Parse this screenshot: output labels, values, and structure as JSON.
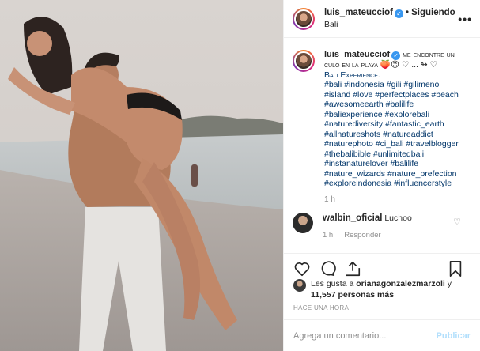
{
  "post": {
    "username": "luis_mateucciof",
    "following_label": "Siguiendo",
    "location": "Bali",
    "more_icon": "ellipsis-icon",
    "photo_alt": "Foto de la publicación"
  },
  "caption": {
    "username": "luis_mateucciof",
    "text": "me encontre un culo en la playa 🍑😉 ♡ ... ↬ ♡",
    "line2": "Bali Experience.",
    "hashtags": "#bali #indonesia #gili #gilimeno #island #love #perfectplaces #beach #awesomeearth #balilife #baliexperience #explorebali #naturediversity #fantastic_earth #allnatureshots #natureaddict #naturephoto #ci_bali #travelblogger #thebalibible #unlimitedbali #instanaturelover #balilife #nature_wizards #nature_prefection #exploreindonesia #influencerstyle",
    "time": "1 h"
  },
  "comment": {
    "username": "walbin_oficial",
    "text": "Luchoo",
    "time": "1 h",
    "reply_label": "Responder"
  },
  "likes": {
    "prefix": "Les gusta a ",
    "user": "orianagonzalezmarzoli",
    "mid": " y",
    "count": "11,557 personas más"
  },
  "timestamp": "HACE UNA HORA",
  "add_comment": {
    "placeholder": "Agrega un comentario...",
    "publish_label": "Publicar"
  },
  "colors": {
    "link": "#003569",
    "muted": "#8e8e8e",
    "verified": "#3897f0",
    "publish_disabled": "#b2dffc"
  }
}
